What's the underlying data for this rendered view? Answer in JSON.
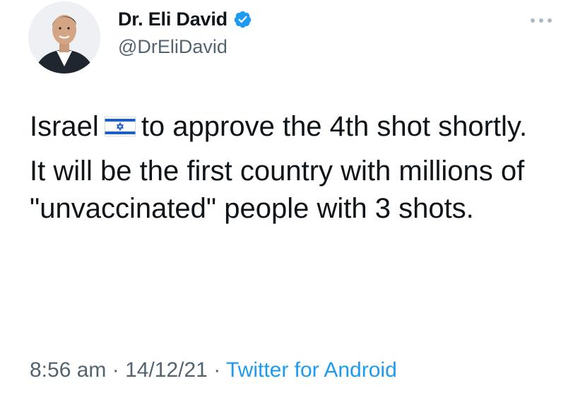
{
  "author": {
    "display_name": "Dr. Eli David",
    "handle": "@DrEliDavid",
    "avatar_icon": "profile-photo",
    "verified_icon": "verified-badge-icon"
  },
  "tweet": {
    "line1_before_flag": "Israel",
    "flag_icon": "israel-flag-icon",
    "line1_after_flag": "to approve the 4th shot shortly.",
    "paragraph2": "It will be the first country with millions of \"unvaccinated\" people with 3 shots."
  },
  "footer": {
    "time": "8:56 am",
    "separator1": " · ",
    "date": "14/12/21",
    "separator2": " · ",
    "source": "Twitter for Android"
  },
  "colors": {
    "text_primary": "#0f1419",
    "text_secondary": "#536471",
    "accent": "#1d9bf0"
  }
}
